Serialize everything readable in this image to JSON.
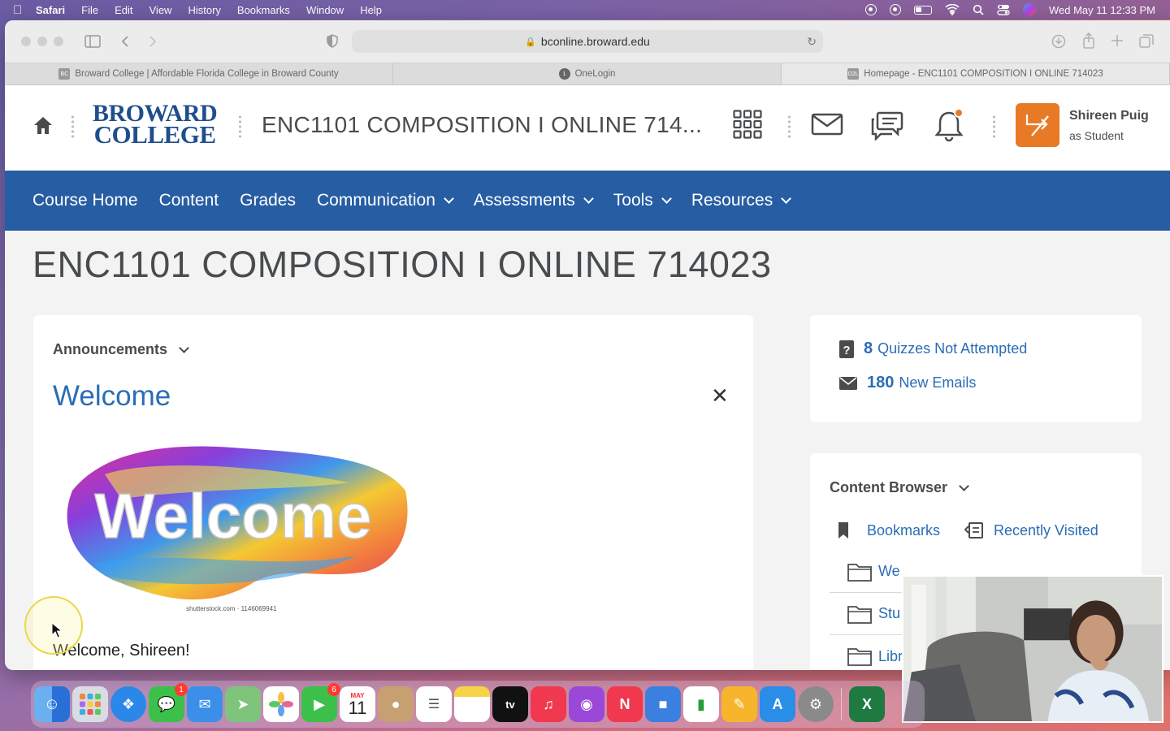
{
  "menubar": {
    "app": "Safari",
    "items": [
      "File",
      "Edit",
      "View",
      "History",
      "Bookmarks",
      "Window",
      "Help"
    ],
    "clock": "Wed May 11  12:33 PM"
  },
  "browser": {
    "url": "bconline.broward.edu",
    "tabs": [
      {
        "favicon": "BC",
        "title": "Broward College | Affordable Florida College in Broward County"
      },
      {
        "favicon": "1",
        "title": "OneLogin"
      },
      {
        "favicon": "D2L",
        "title": "Homepage - ENC1101 COMPOSITION I ONLINE 714023"
      }
    ]
  },
  "header": {
    "logo_line1": "BROWARD",
    "logo_line2": "COLLEGE",
    "course_title": "ENC1101 COMPOSITION I ONLINE 714...",
    "user_name": "Shireen Puig",
    "user_role": "as Student"
  },
  "nav": {
    "items": [
      {
        "label": "Course Home",
        "dropdown": false
      },
      {
        "label": "Content",
        "dropdown": false
      },
      {
        "label": "Grades",
        "dropdown": false
      },
      {
        "label": "Communication",
        "dropdown": true
      },
      {
        "label": "Assessments",
        "dropdown": true
      },
      {
        "label": "Tools",
        "dropdown": true
      },
      {
        "label": "Resources",
        "dropdown": true
      }
    ]
  },
  "page": {
    "title": "ENC1101 COMPOSITION I ONLINE 714023"
  },
  "announcements": {
    "heading": "Announcements",
    "item_title": "Welcome",
    "image_text": "Welcome",
    "image_caption": "shutterstock.com · 1146069941",
    "body": "Welcome, Shireen!"
  },
  "stats": {
    "quizzes_count": "8",
    "quizzes_label": "Quizzes Not Attempted",
    "emails_count": "180",
    "emails_label": "New Emails"
  },
  "content_browser": {
    "heading": "Content Browser",
    "bookmarks": "Bookmarks",
    "recently_visited": "Recently Visited",
    "folders": [
      "We",
      "Stu",
      "Libr"
    ]
  },
  "dock": {
    "calendar_month": "MAY",
    "calendar_day": "11",
    "messages_badge": "1",
    "facetime_badge": "6"
  },
  "colors": {
    "nav_blue": "#275da3",
    "link_blue": "#2a6db5",
    "accent_orange": "#e87a26"
  }
}
